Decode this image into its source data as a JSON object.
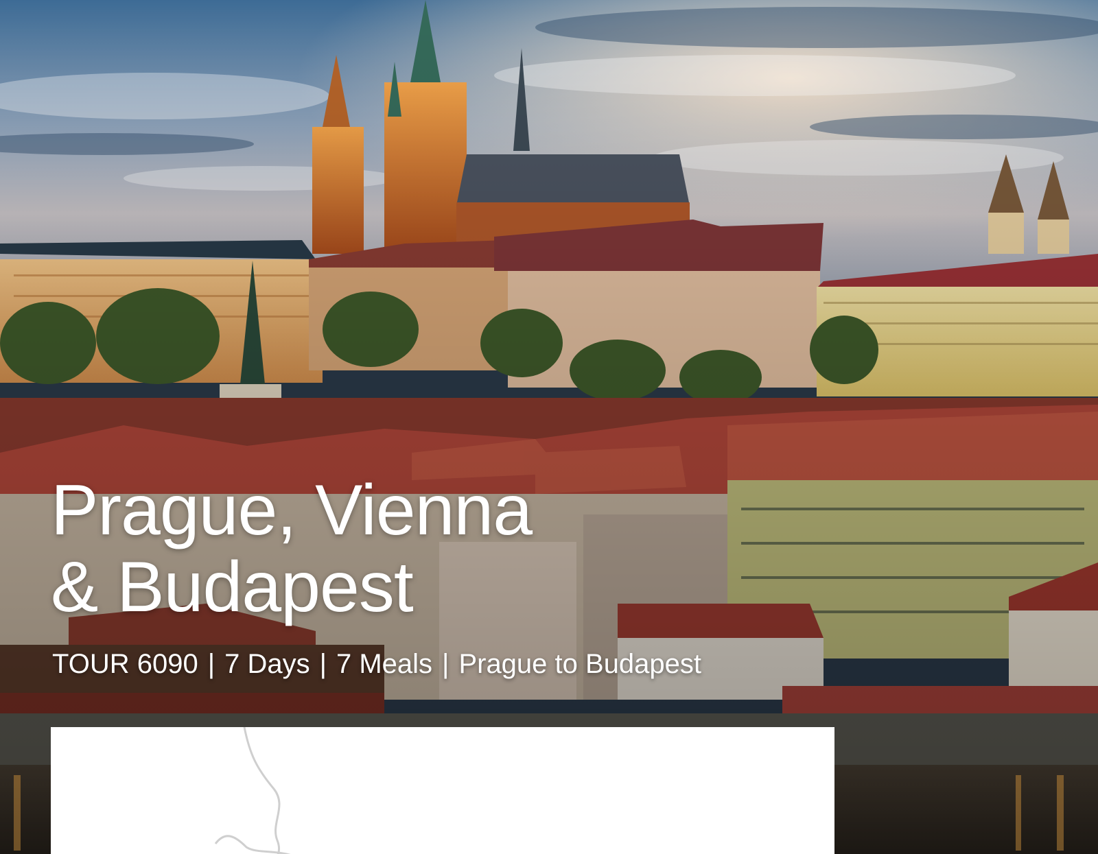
{
  "tour": {
    "title_line1": "Prague, Vienna",
    "title_line2": "& Budapest",
    "code": "TOUR 6090",
    "days": "7 Days",
    "meals": "7 Meals",
    "route": "Prague to Budapest",
    "separator": "|"
  },
  "colors": {
    "sky_top": "#3f6f9a",
    "sky_mid": "#a7b4c6",
    "sky_glow": "#f2dcc4",
    "castle_orange": "#d9782b",
    "roof_red": "#a9372d",
    "building_yellow": "#c9c58a",
    "river": "#3a3028",
    "text": "#ffffff"
  }
}
